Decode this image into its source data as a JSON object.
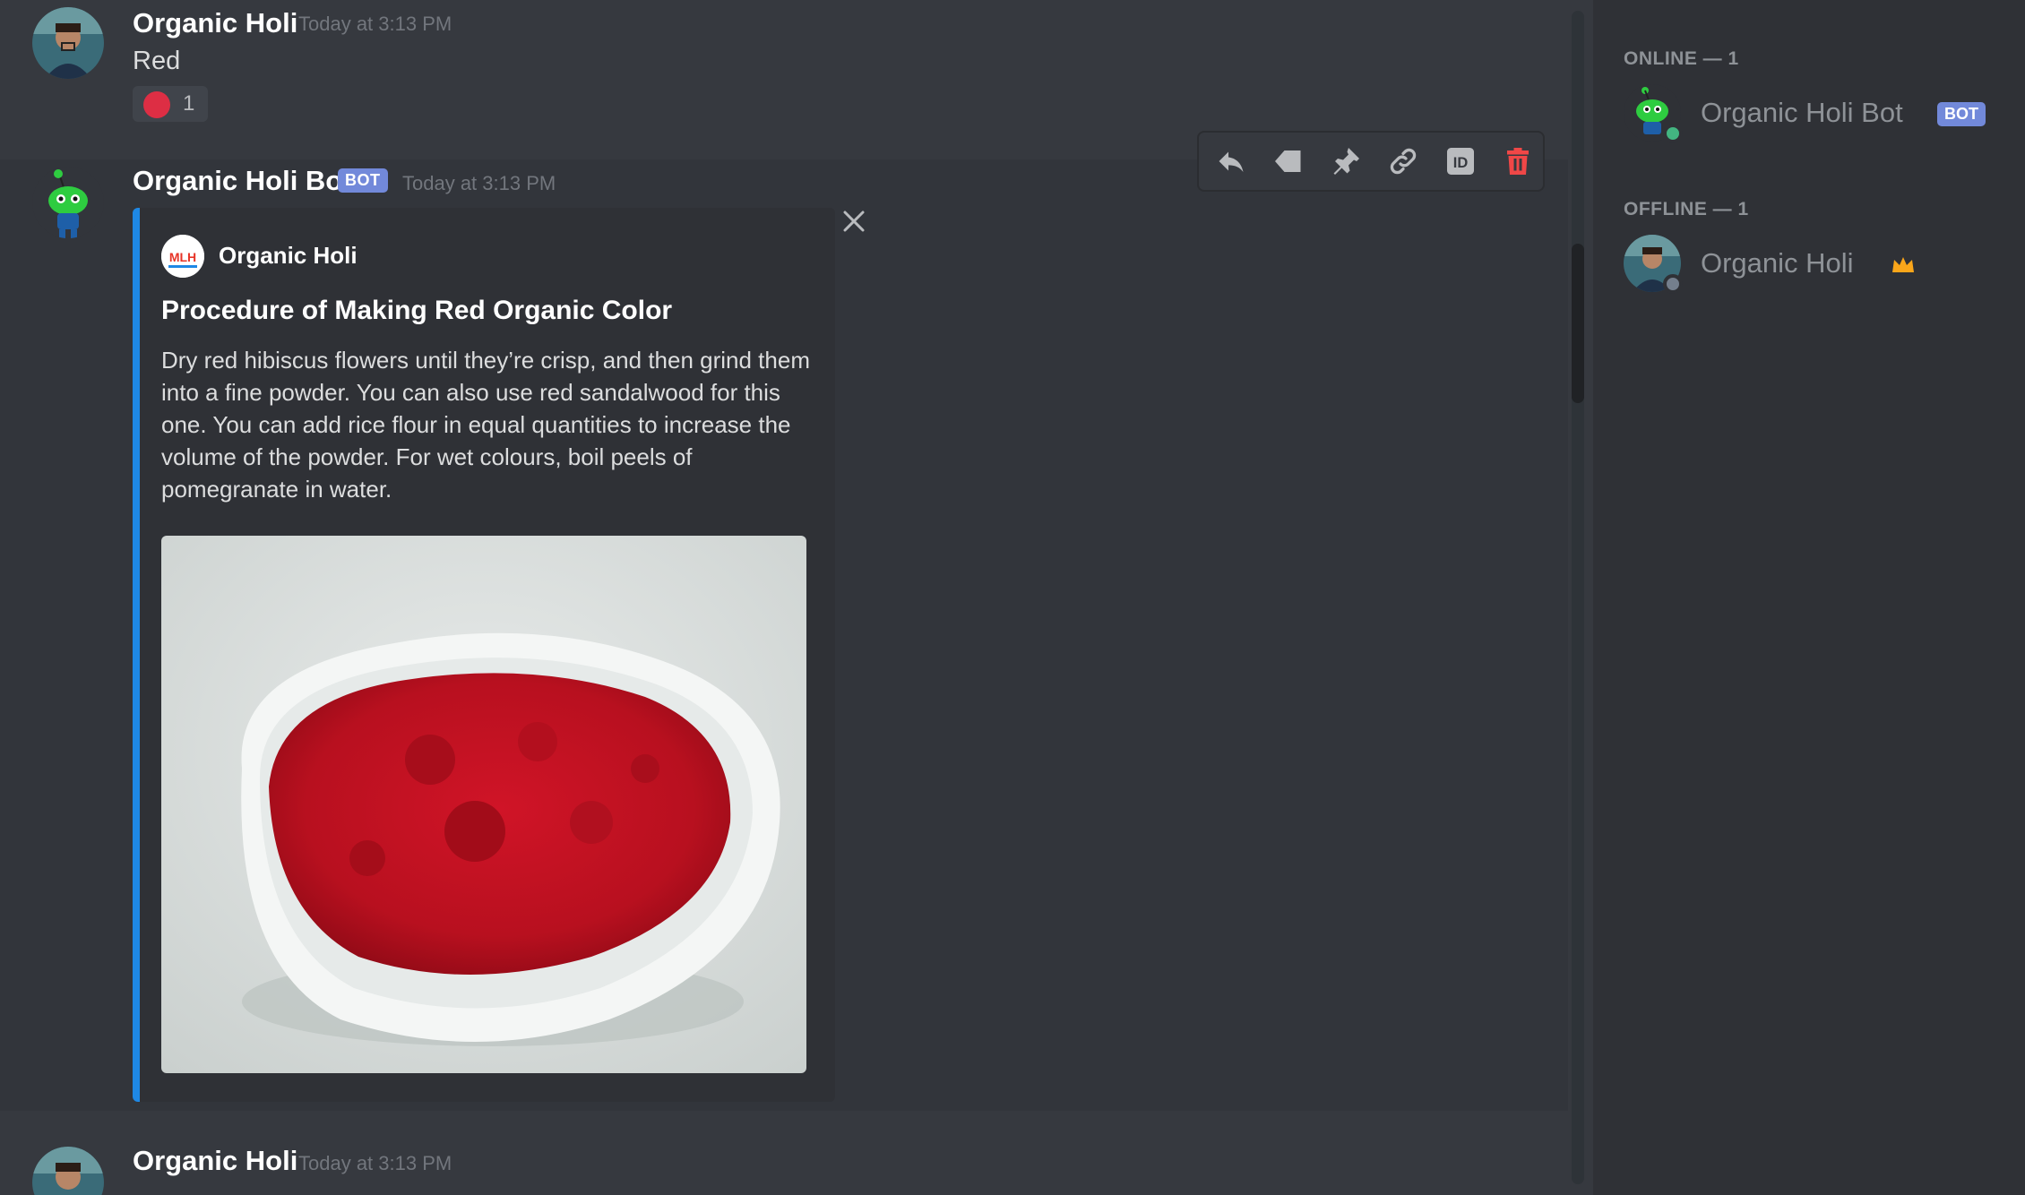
{
  "messages": [
    {
      "author": "Organic Holi",
      "timestamp": "Today at 3:13 PM",
      "content": "Red",
      "reaction": {
        "emoji": "red-circle",
        "count": "1"
      }
    },
    {
      "author": "Organic Holi Bot",
      "bot_tag": "BOT",
      "timestamp": "Today at 3:13 PM",
      "embed": {
        "author": "Organic Holi",
        "author_icon_text": "MLH",
        "title": "Procedure of Making Red Organic Color",
        "description": "Dry red hibiscus flowers until they’re crisp, and then grind them into a fine powder. You can also use red sandalwood for this one. You can add rice flour in equal quantities to increase the volume of the powder. For wet colours, boil peels of pomegranate in water.",
        "accent_color": "#1e88e5",
        "image": "red-powder-in-white-bowl"
      },
      "toolbar": [
        "reply-icon",
        "tag-icon",
        "pin-icon",
        "link-icon",
        "id-icon",
        "trash-icon"
      ]
    },
    {
      "author": "Organic Holi",
      "timestamp": "Today at 3:13 PM"
    }
  ],
  "members": {
    "online_header": "ONLINE — 1",
    "offline_header": "OFFLINE — 1",
    "online": [
      {
        "name": "Organic Holi Bot",
        "tag": "BOT",
        "status_color": "#43b581"
      }
    ],
    "offline": [
      {
        "name": "Organic Holi",
        "badge": "crown-icon",
        "status_color": "#747f8d"
      }
    ]
  },
  "colors": {
    "bot_tag": "#7289da",
    "delete": "#f04747",
    "crown": "#faa61a"
  }
}
